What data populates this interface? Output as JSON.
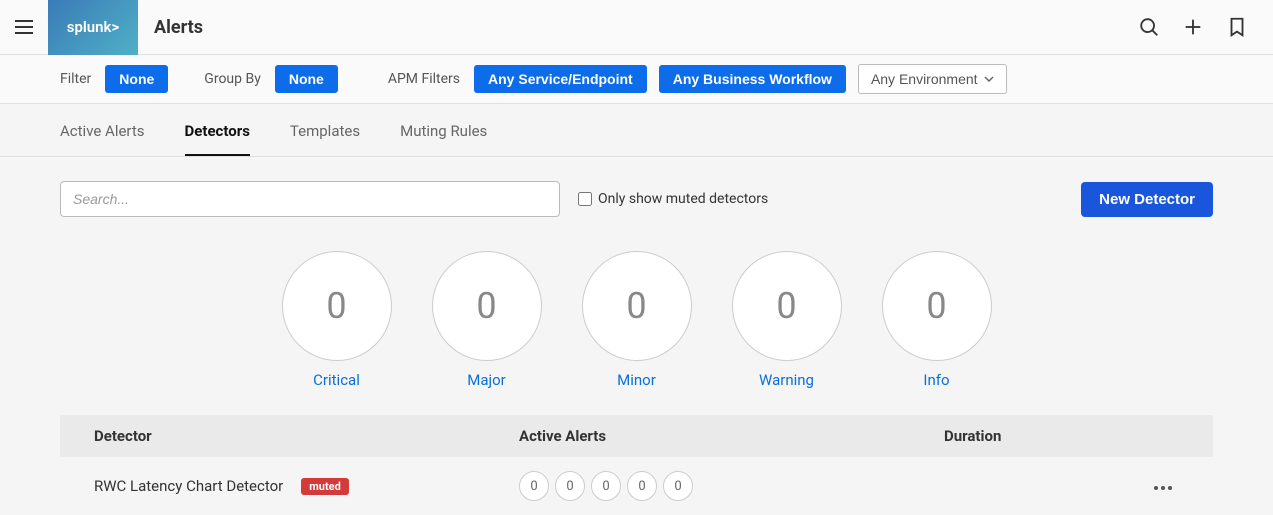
{
  "header": {
    "logo_text": "splunk>",
    "page_title": "Alerts"
  },
  "filters": {
    "filter_label": "Filter",
    "filter_value": "None",
    "groupby_label": "Group By",
    "groupby_value": "None",
    "apm_label": "APM Filters",
    "apm_service": "Any Service/Endpoint",
    "apm_workflow": "Any Business Workflow",
    "environment": "Any Environment"
  },
  "tabs": {
    "active_alerts": "Active Alerts",
    "detectors": "Detectors",
    "templates": "Templates",
    "muting_rules": "Muting Rules"
  },
  "controls": {
    "search_placeholder": "Search...",
    "muted_only_label": "Only show muted detectors",
    "new_detector": "New Detector"
  },
  "summary": [
    {
      "count": "0",
      "label": "Critical"
    },
    {
      "count": "0",
      "label": "Major"
    },
    {
      "count": "0",
      "label": "Minor"
    },
    {
      "count": "0",
      "label": "Warning"
    },
    {
      "count": "0",
      "label": "Info"
    }
  ],
  "table": {
    "headers": {
      "detector": "Detector",
      "active_alerts": "Active Alerts",
      "duration": "Duration"
    },
    "rows": [
      {
        "name": "RWC Latency Chart Detector",
        "muted_badge": "muted",
        "alerts": [
          "0",
          "0",
          "0",
          "0",
          "0"
        ],
        "duration": ""
      }
    ]
  }
}
